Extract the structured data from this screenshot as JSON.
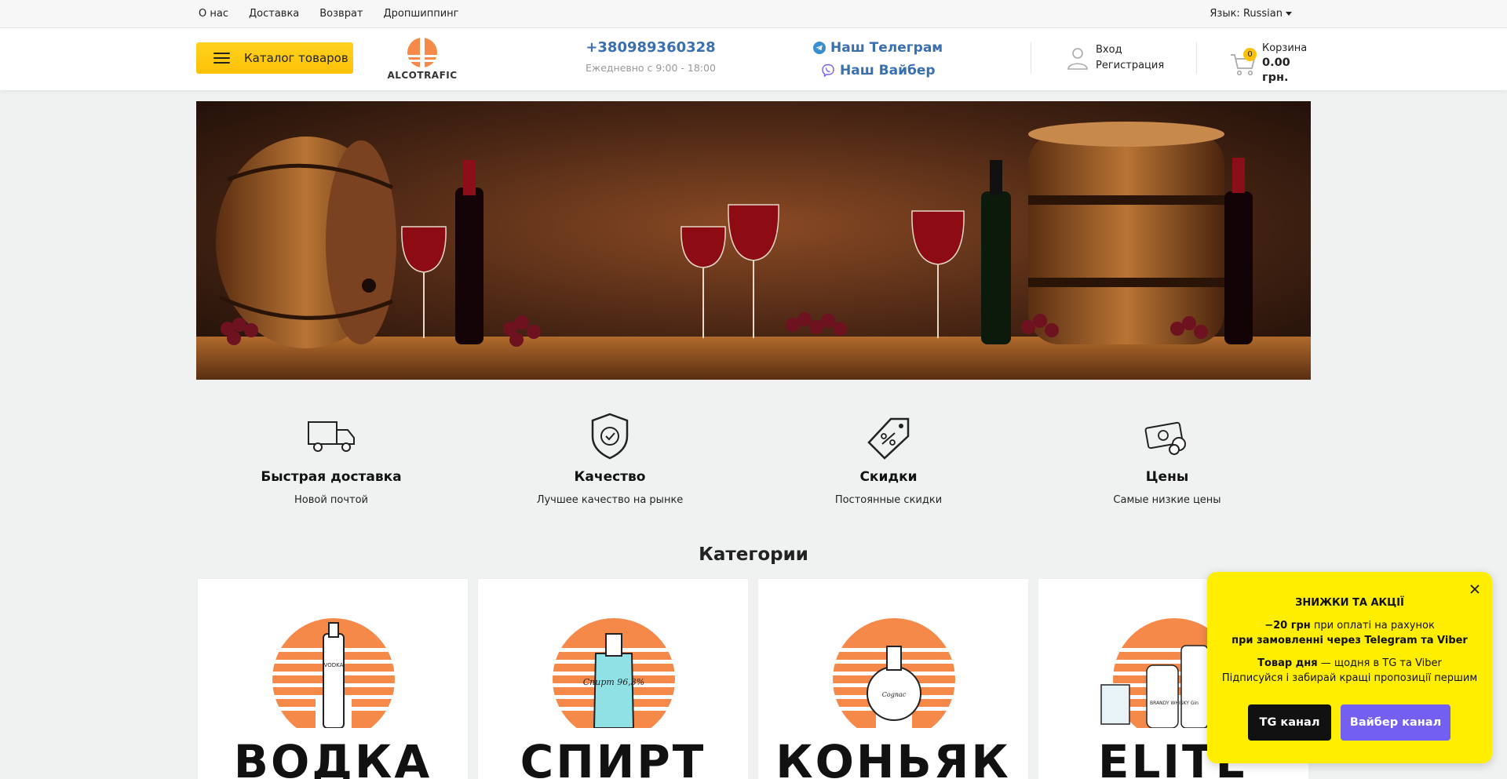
{
  "topnav": {
    "items": [
      "О нас",
      "Доставка",
      "Возврат",
      "Дропшиппинг"
    ],
    "language": "Язык: Russian"
  },
  "header": {
    "catalog_label": "Каталог товаров",
    "logo_text": "ALCOTRAFIC",
    "phone": "+380989360328",
    "hours": "Ежедневно с 9:00 - 18:00",
    "telegram_label": "Наш Телеграм",
    "viber_label": "Наш Вайбер",
    "login_label": "Вход",
    "register_label": "Регистрация",
    "cart_count": "0",
    "cart_label": "Корзина",
    "cart_total": "0.00 грн."
  },
  "features": [
    {
      "title": "Быстрая доставка",
      "subtitle": "Новой почтой",
      "icon": "truck-icon"
    },
    {
      "title": "Качество",
      "subtitle": "Лучшее качество на рынке",
      "icon": "shield-check-icon"
    },
    {
      "title": "Скидки",
      "subtitle": "Постоянные скидки",
      "icon": "price-tag-icon"
    },
    {
      "title": "Цены",
      "subtitle": "Самые низкие цены",
      "icon": "money-icon"
    }
  ],
  "categories_title": "Категории",
  "categories": [
    {
      "label": "ВОДКА",
      "bottle_label": "VODKA"
    },
    {
      "label": "СПИРТ",
      "bottle_label": "Спирт 96,3%"
    },
    {
      "label": "КОНЬЯК",
      "bottle_label": "Cognac"
    },
    {
      "label": "ELITE",
      "bottle_label": "BRANDY WHISKY Gin"
    }
  ],
  "popup": {
    "title": "ЗНИЖКИ ТА АКЦІЇ",
    "line1_bold": "−20 грн",
    "line1_rest": " при оплаті на рахунок",
    "line2": "при замовленні через Telegram та Viber",
    "line3_bold": "Товар дня",
    "line3_rest": " — щодня в TG та Viber",
    "line4": "Підписуйся і забирай кращі пропозиції першим",
    "tg_button": "TG канал",
    "viber_button": "Вайбер канал"
  },
  "colors": {
    "accent": "#ffc107",
    "link_blue": "#3a6fb0",
    "popup_bg": "#ffee00",
    "viber": "#7360f2",
    "logo_orange": "#f5894a"
  }
}
